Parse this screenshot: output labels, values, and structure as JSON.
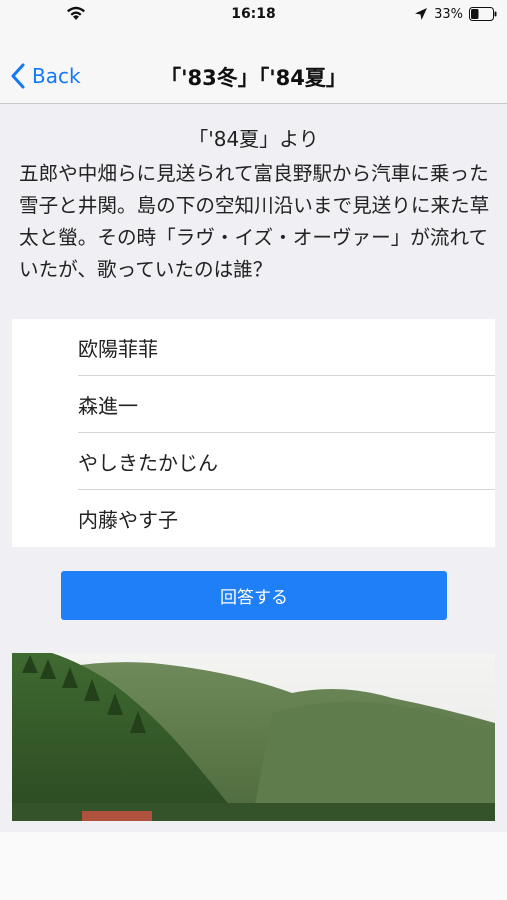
{
  "status_bar": {
    "time": "16:18",
    "battery_percent": "33%",
    "icons": [
      "wifi-icon",
      "location-arrow-icon",
      "battery-icon"
    ]
  },
  "nav": {
    "back_label": "Back",
    "title": "「'83冬」「'84夏」"
  },
  "question": {
    "source": "「'84夏」より",
    "text": "五郎や中畑らに見送られて富良野駅から汽車に乗った雪子と井関。島の下の空知川沿いまで見送りに来た草太と螢。その時「ラヴ・イズ・オーヴァー」が流れていたが、歌っていたのは誰？"
  },
  "answers": [
    {
      "label": "欧陽菲菲"
    },
    {
      "label": "森進一"
    },
    {
      "label": "やしきたかじん"
    },
    {
      "label": "内藤やす子"
    }
  ],
  "submit_label": "回答する",
  "colors": {
    "accent": "#1479f4",
    "button": "#1e7ff6",
    "background": "#efeff4"
  }
}
